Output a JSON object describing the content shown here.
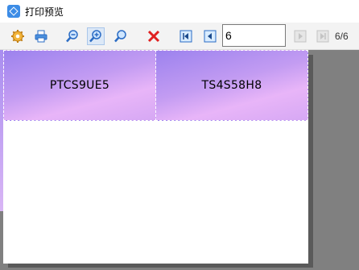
{
  "window": {
    "title": "打印预览"
  },
  "toolbar": {
    "buttons": [
      {
        "name": "settings",
        "icon": "gear-icon"
      },
      {
        "name": "print",
        "icon": "printer-icon"
      },
      {
        "name": "zoom-out",
        "icon": "zoom-out-icon"
      },
      {
        "name": "zoom-in",
        "icon": "zoom-in-icon"
      },
      {
        "name": "zoom-fit",
        "icon": "magnifier-icon"
      },
      {
        "name": "close",
        "icon": "close-icon"
      },
      {
        "name": "first-page",
        "icon": "first-page-icon"
      },
      {
        "name": "previous-page",
        "icon": "previous-page-icon"
      },
      {
        "name": "next-page",
        "icon": "next-page-icon"
      },
      {
        "name": "last-page",
        "icon": "last-page-icon"
      }
    ],
    "page_input_value": "6",
    "page_count": "6/6"
  },
  "labels": [
    {
      "text": "PTCS9UE5"
    },
    {
      "text": "TS4S58H8"
    }
  ],
  "colors": {
    "accent": "#3c8ce6",
    "label_gradient_start": "#9c82ee",
    "label_gradient_end": "#e8b5f8",
    "preview_bg": "#808080"
  }
}
